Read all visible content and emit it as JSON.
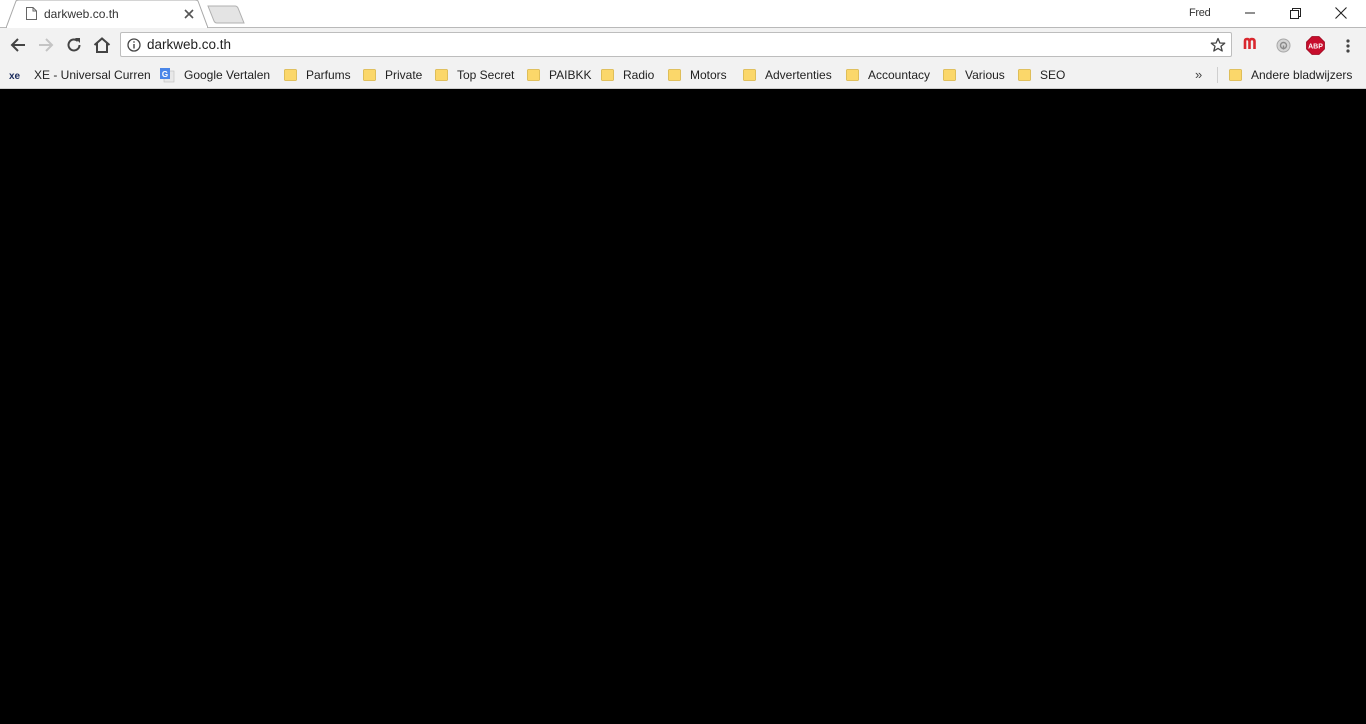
{
  "browser": {
    "tab": {
      "title": "darkweb.co.th"
    },
    "profile_name": "Fred",
    "omnibox": {
      "url": "darkweb.co.th"
    },
    "extensions": [
      {
        "name": "mega-extension-icon",
        "label": "m",
        "color": "#d9272e"
      },
      {
        "name": "generic-extension-icon",
        "label": "",
        "color": "#9e9e9e"
      },
      {
        "name": "adblock-plus-icon",
        "label": "ABP",
        "color": "#c70d2c"
      }
    ]
  },
  "bookmarks": {
    "items": [
      {
        "label": "XE - Universal Curren",
        "icon": "xe-icon"
      },
      {
        "label": "Google Vertalen",
        "icon": "google-translate-icon"
      },
      {
        "label": "Parfums",
        "icon": "folder-icon"
      },
      {
        "label": "Private",
        "icon": "folder-icon"
      },
      {
        "label": "Top Secret",
        "icon": "folder-icon"
      },
      {
        "label": "PAIBKK",
        "icon": "folder-icon"
      },
      {
        "label": "Radio",
        "icon": "folder-icon"
      },
      {
        "label": "Motors",
        "icon": "folder-icon"
      },
      {
        "label": "Advertenties",
        "icon": "folder-icon"
      },
      {
        "label": "Accountacy",
        "icon": "folder-icon"
      },
      {
        "label": "Various",
        "icon": "folder-icon"
      },
      {
        "label": "SEO",
        "icon": "folder-icon"
      }
    ],
    "overflow_label": "»",
    "other_bookmarks": "Andere bladwijzers"
  },
  "page": {
    "background": "#000000"
  }
}
